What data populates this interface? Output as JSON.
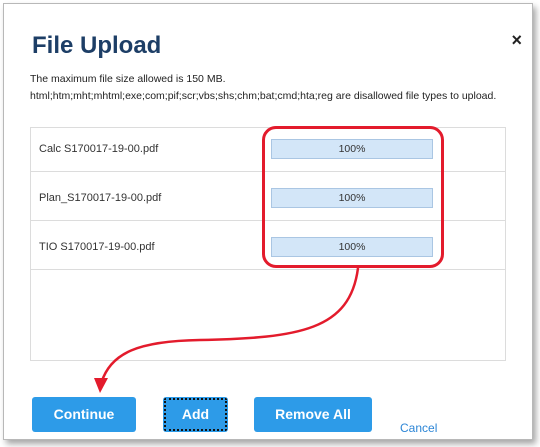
{
  "dialog": {
    "title": "File Upload",
    "close_glyph": "×",
    "info_max_size": "The maximum file size allowed is 150 MB.",
    "info_disallowed": "html;htm;mht;mhtml;exe;com;pif;scr;vbs;shs;chm;bat;cmd;hta;reg are disallowed file types to upload."
  },
  "files": [
    {
      "name": "Calc S170017-19-00.pdf",
      "progress_label": "100%",
      "progress": 1.0
    },
    {
      "name": "Plan_S170017-19-00.pdf",
      "progress_label": "100%",
      "progress": 1.0
    },
    {
      "name": "TIO S170017-19-00.pdf",
      "progress_label": "100%",
      "progress": 1.0
    }
  ],
  "buttons": {
    "continue": "Continue",
    "add": "Add",
    "remove_all": "Remove All",
    "cancel": "Cancel"
  },
  "colors": {
    "title": "#1d3e66",
    "button": "#2d9be8",
    "annotation": "#e31b2c",
    "progress_fill": "#d6e8f8"
  },
  "icons": {
    "close": "close-icon"
  }
}
